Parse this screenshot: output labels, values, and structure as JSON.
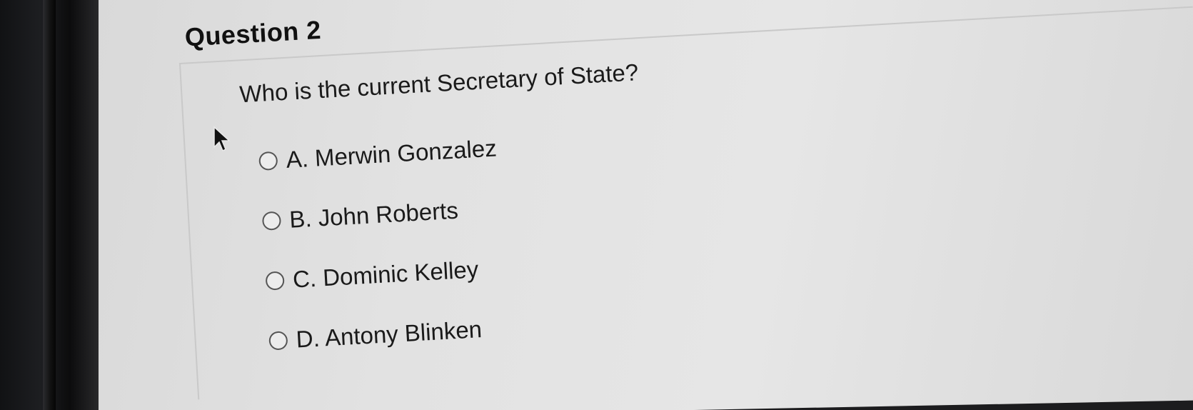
{
  "question": {
    "title": "Question 2",
    "prompt": "Who is the current Secretary of State?",
    "options": [
      {
        "label": "A. Merwin Gonzalez"
      },
      {
        "label": "B. John Roberts"
      },
      {
        "label": "C. Dominic Kelley"
      },
      {
        "label": "D. Antony Blinken"
      }
    ],
    "selected": null
  },
  "icons": {
    "cursor": "mouse-pointer-icon"
  }
}
